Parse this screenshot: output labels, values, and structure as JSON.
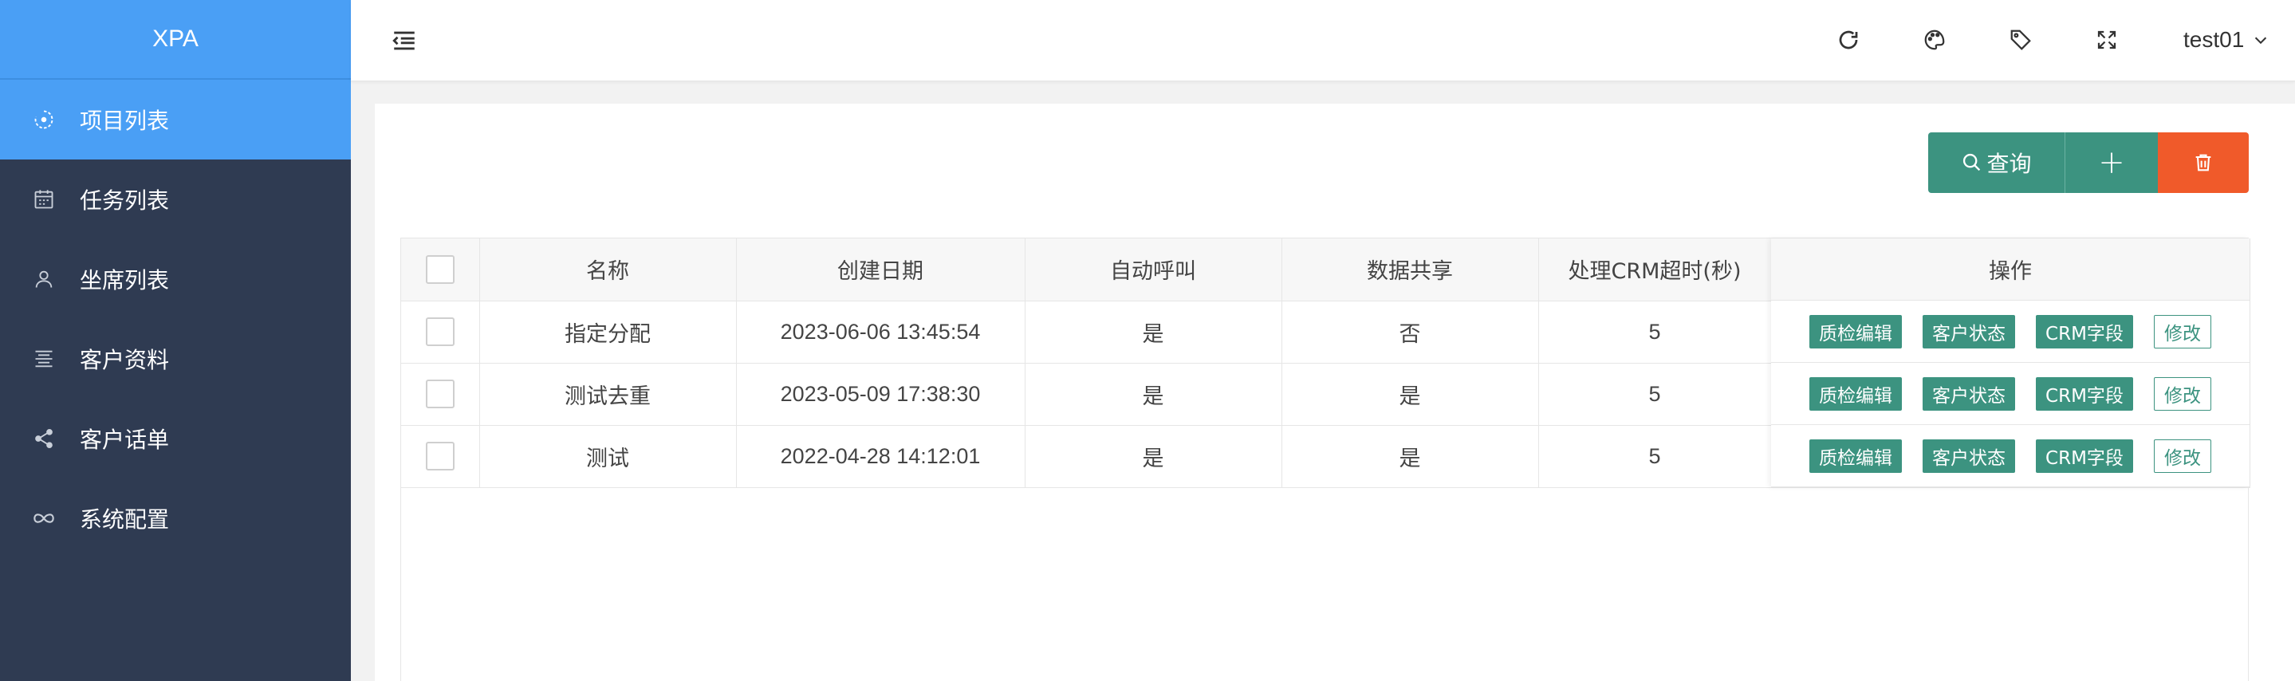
{
  "app": {
    "logo": "XPA"
  },
  "sidebar": {
    "items": [
      {
        "label": "项目列表",
        "icon": "project-icon",
        "active": true
      },
      {
        "label": "任务列表",
        "icon": "calendar-icon",
        "active": false
      },
      {
        "label": "坐席列表",
        "icon": "user-icon",
        "active": false
      },
      {
        "label": "客户资料",
        "icon": "list-icon",
        "active": false
      },
      {
        "label": "客户话单",
        "icon": "share-icon",
        "active": false
      },
      {
        "label": "系统配置",
        "icon": "infinity-icon",
        "active": false
      }
    ]
  },
  "header": {
    "user": "test01",
    "icons": [
      "refresh-icon",
      "palette-icon",
      "tag-icon",
      "fullscreen-icon"
    ]
  },
  "toolbar": {
    "search_label": "查询",
    "add_symbol": "+",
    "delete_icon": "trash-icon"
  },
  "table": {
    "headers": [
      "名称",
      "创建日期",
      "自动呼叫",
      "数据共享",
      "处理CRM超时(秒)",
      "操作"
    ],
    "rows": [
      {
        "name": "指定分配",
        "date": "2023-06-06 13:45:54",
        "auto": "是",
        "share": "否",
        "timeout": "5"
      },
      {
        "name": "测试去重",
        "date": "2023-05-09 17:38:30",
        "auto": "是",
        "share": "是",
        "timeout": "5"
      },
      {
        "name": "测试",
        "date": "2022-04-28 14:12:01",
        "auto": "是",
        "share": "是",
        "timeout": "5"
      }
    ],
    "actions": [
      "质检编辑",
      "客户状态",
      "CRM字段",
      "修改"
    ]
  }
}
